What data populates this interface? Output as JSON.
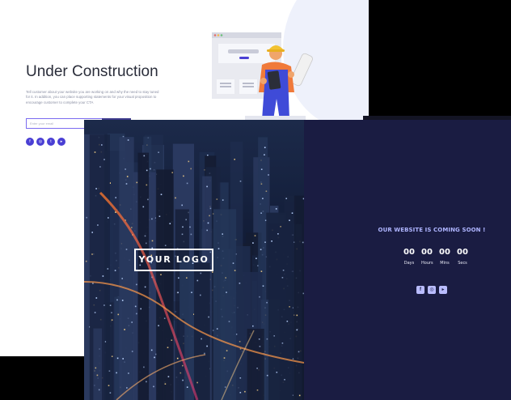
{
  "under_construction": {
    "title": "Under Construction",
    "description": "Tell customer about your website you are working on and why the need to stay tuned for it. In addition, you can place supporting statements for your visual proposition to encourage customer to complete your CTA",
    "email_placeholder": "Enter your email",
    "social_icons": [
      "facebook-icon",
      "instagram-icon",
      "twitter-icon",
      "youtube-icon"
    ],
    "accent_color": "#4a3fd4"
  },
  "coming_soon": {
    "logo_text": "YOUR LOGO",
    "heading": "OUR WEBSITE IS COMING SOON !",
    "countdown": [
      {
        "value": "00",
        "label": "Days"
      },
      {
        "value": "00",
        "label": "Hours"
      },
      {
        "value": "00",
        "label": "Mins"
      },
      {
        "value": "00",
        "label": "Secs"
      }
    ],
    "social_icons": [
      "facebook-icon",
      "instagram-icon",
      "youtube-icon"
    ],
    "panel_color": "#1a1c42",
    "heading_color": "#aeb4ff"
  }
}
